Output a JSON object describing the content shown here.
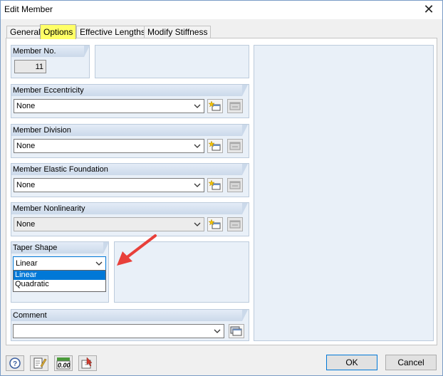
{
  "window": {
    "title": "Edit Member",
    "close_glyph": "✕"
  },
  "tabs": [
    {
      "label": "General",
      "active": false
    },
    {
      "label": "Options",
      "active": true
    },
    {
      "label": "Effective Lengths",
      "active": false
    },
    {
      "label": "Modify Stiffness",
      "active": false
    }
  ],
  "member_no": {
    "label": "Member No.",
    "value": "11"
  },
  "eccentricity": {
    "label": "Member Eccentricity",
    "value": "None"
  },
  "division": {
    "label": "Member Division",
    "value": "None"
  },
  "foundation": {
    "label": "Member Elastic Foundation",
    "value": "None"
  },
  "nonlinearity": {
    "label": "Member Nonlinearity",
    "value": "None"
  },
  "taper": {
    "label": "Taper Shape",
    "value": "Linear",
    "options": [
      "Linear",
      "Quadratic"
    ],
    "selected_index": 0
  },
  "comment": {
    "label": "Comment",
    "value": ""
  },
  "buttons": {
    "ok": "OK",
    "cancel": "Cancel",
    "numeric_icon_text": "0.00"
  },
  "colors": {
    "active_tab": "#ffff66",
    "selection": "#0078d7",
    "arrow": "#e8403a",
    "group_bg": "#e9f0f8"
  }
}
